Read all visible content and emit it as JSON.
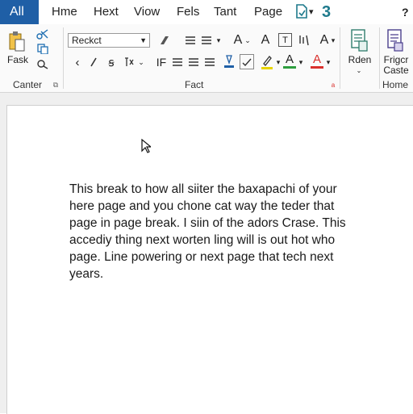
{
  "tabs": {
    "file": "All",
    "items": [
      "Hme",
      "Hext",
      "Viow",
      "Fels",
      "Tant",
      "Page"
    ],
    "extra": "3",
    "help": "?"
  },
  "clipboard": {
    "paste_label": "Fask",
    "group_label": "Canter"
  },
  "font": {
    "name_value": "Reckct",
    "group_label": "Fact",
    "buttons": [
      "A",
      "A",
      "T",
      "A",
      "IF",
      "A",
      "A"
    ],
    "colors": {
      "highlight": "#e8d400",
      "green": "#2e9e3f",
      "red": "#d9302c"
    }
  },
  "right": {
    "read_label": "Rden",
    "finger_label": "Frigcr\nCaste",
    "home_label": "Home"
  },
  "document": {
    "lines": [
      "This break to how all siiter the baxapachi of your",
      "here page and you chone cat way the teder that",
      "page in page break. I siin of the adors Crase. This",
      "accediy thing next worten ling will is out hot who",
      "page. Line powering or next page that tech next",
      "years."
    ]
  }
}
